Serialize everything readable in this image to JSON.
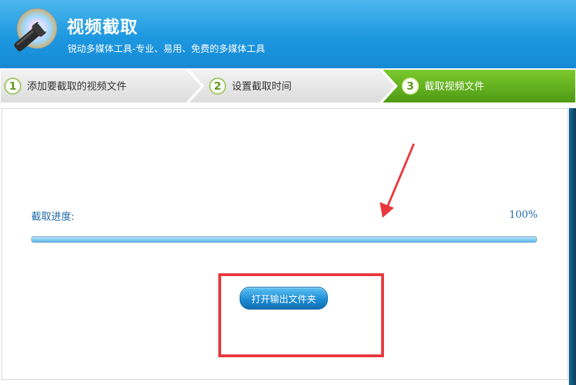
{
  "header": {
    "title": "视频截取",
    "subtitle": "锐动多媒体工具-专业、易用、免费的多媒体工具"
  },
  "steps": [
    {
      "num": "1",
      "label": "添加要截取的视频文件"
    },
    {
      "num": "2",
      "label": "设置截取时间"
    },
    {
      "num": "3",
      "label": "截取视频文件"
    }
  ],
  "progress": {
    "label": "截取进度:",
    "percent_text": "100%",
    "value": 1.0
  },
  "actions": {
    "open_folder": "打开输出文件夹"
  },
  "colors": {
    "header_blue": "#1d98e0",
    "active_step_green": "#5aa418",
    "annotation_red": "#e8383d"
  }
}
